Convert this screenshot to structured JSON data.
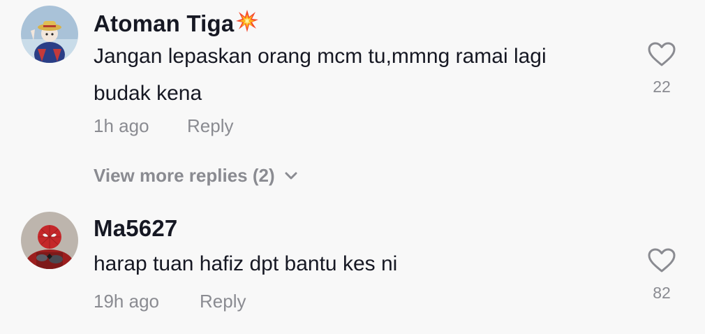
{
  "comments": [
    {
      "username": "Atoman Tiga",
      "username_emoji": "collision-icon",
      "text": "Jangan lepaskan orang mcm tu,mmng ramai lagi budak kena",
      "time": "1h ago",
      "reply_label": "Reply",
      "like_count": "22",
      "view_more_label": "View more replies (2)"
    },
    {
      "username": "Ma5627",
      "text": "harap tuan hafiz dpt bantu kes ni",
      "time": "19h ago",
      "reply_label": "Reply",
      "like_count": "82"
    }
  ],
  "colors": {
    "background": "#f8f8f8",
    "text_primary": "#161823",
    "text_secondary": "#8a8b91"
  }
}
